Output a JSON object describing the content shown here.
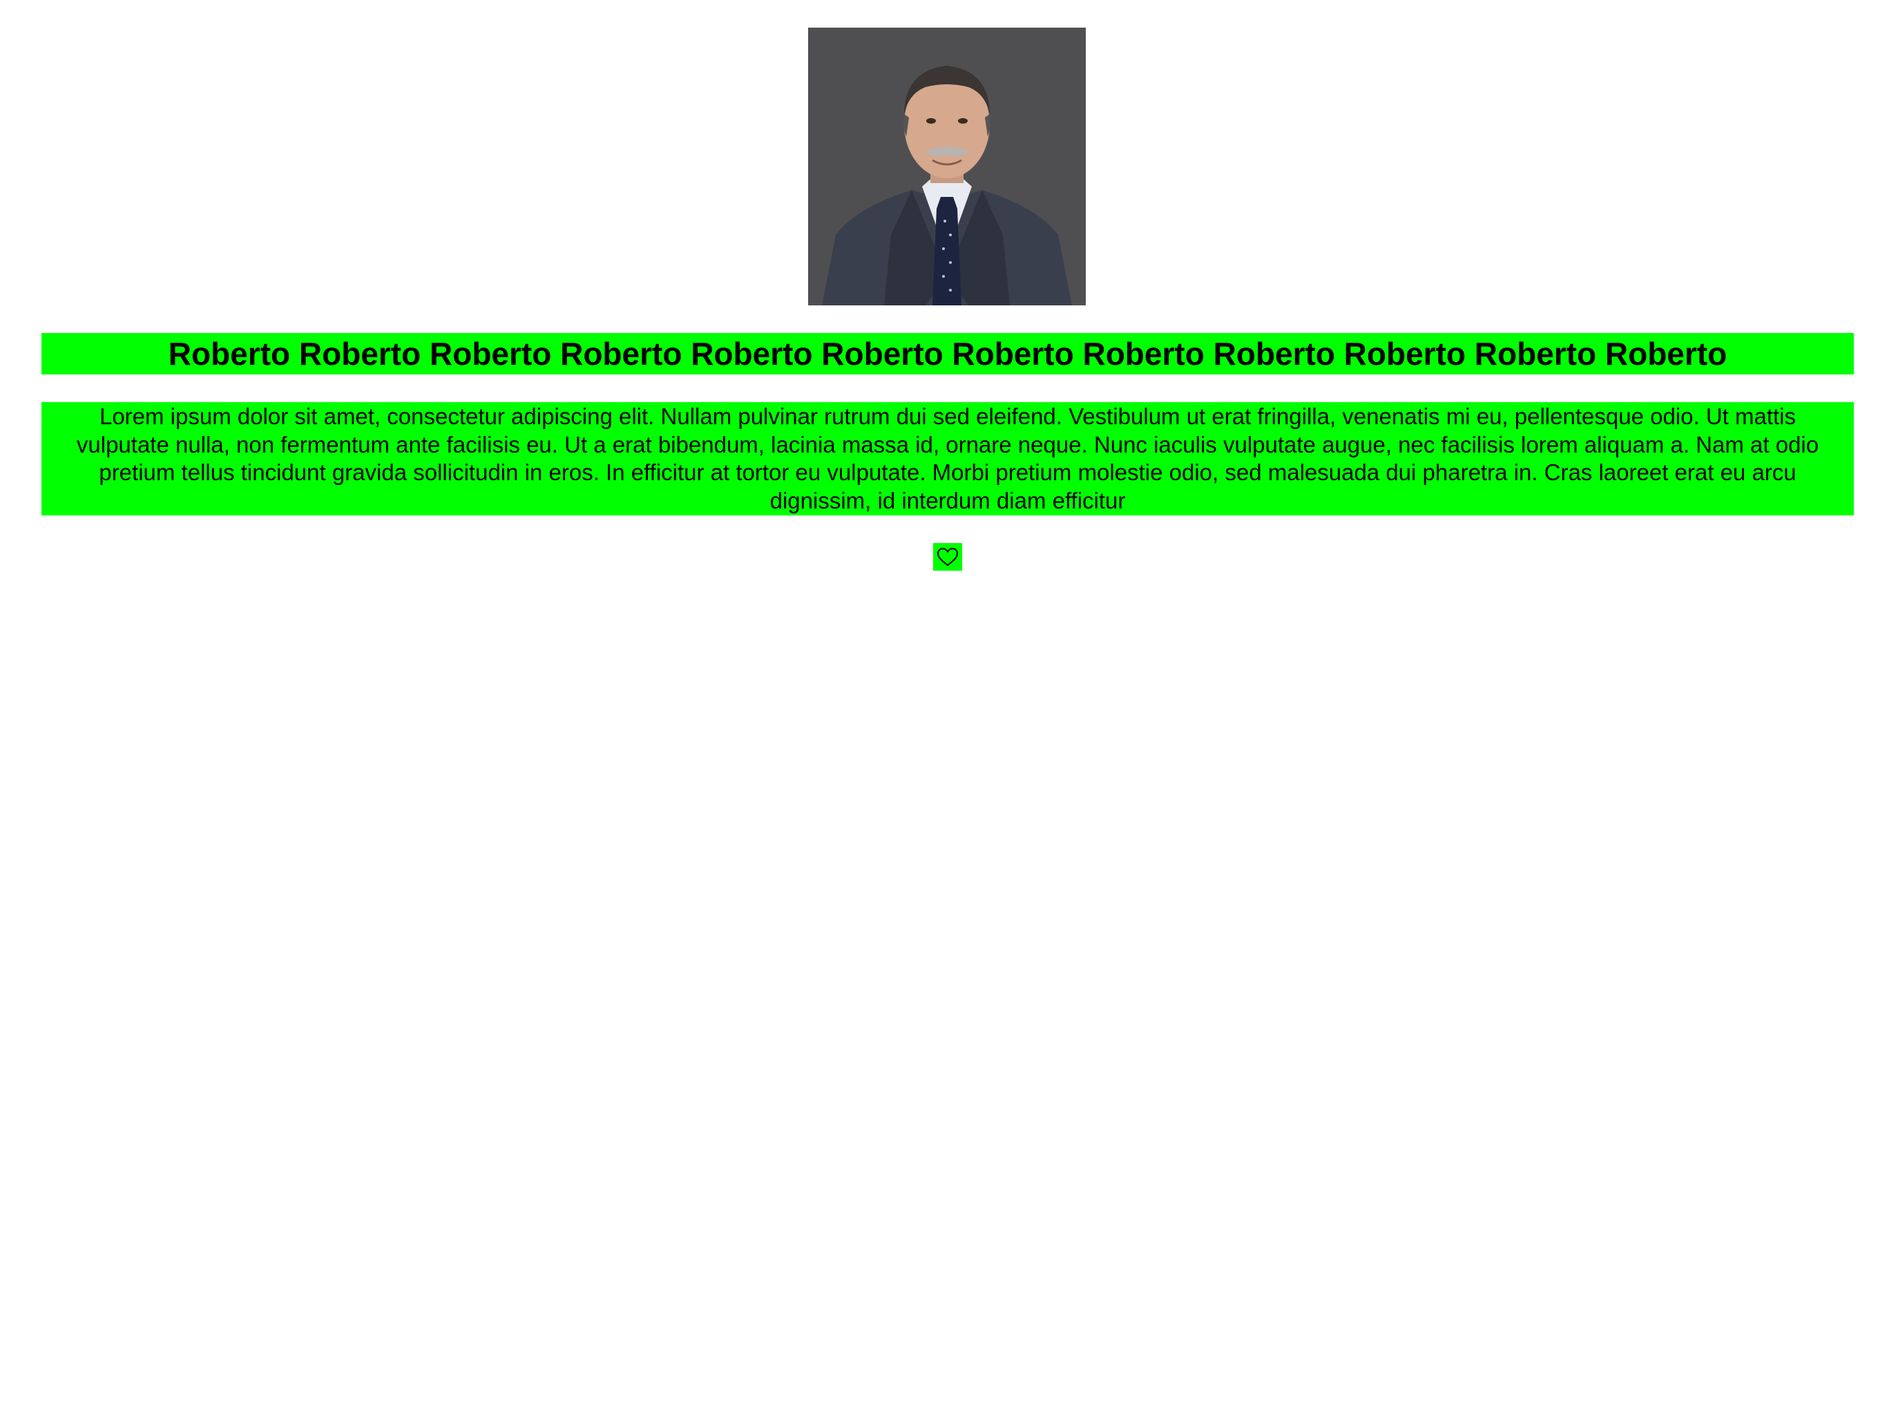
{
  "profile": {
    "photo_alt": "Profile photo",
    "name": "Roberto Roberto Roberto Roberto Roberto Roberto Roberto Roberto Roberto Roberto Roberto Roberto",
    "bio": "Lorem ipsum dolor sit amet, consectetur adipiscing elit. Nullam pulvinar rutrum dui sed eleifend. Vestibulum ut erat fringilla, venenatis mi eu, pellentesque odio. Ut mattis vulputate nulla, non fermentum ante facilisis eu. Ut a erat bibendum, lacinia massa id, ornare neque. Nunc iaculis vulputate augue, nec facilisis lorem aliquam a. Nam at odio pretium tellus tincidunt gravida sollicitudin in eros. In efficitur at tortor eu vulputate. Morbi pretium molestie odio, sed malesuada dui pharetra in. Cras laoreet erat eu arcu dignissim, id interdum diam efficitur"
  },
  "actions": {
    "like_icon": "heart-icon",
    "like_label": "Like"
  },
  "colors": {
    "highlight": "#00ff00",
    "background": "#ffffff",
    "text": "#000000"
  }
}
